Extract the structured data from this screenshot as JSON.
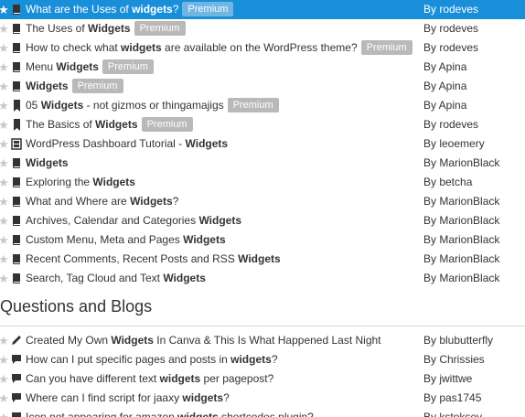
{
  "resources": [
    {
      "title_parts": [
        {
          "t": "What are the Uses of "
        },
        {
          "t": "widgets",
          "b": true
        },
        {
          "t": "?"
        }
      ],
      "premium": "Premium",
      "author": "By rodeves",
      "icon": "book-icon",
      "selected": true
    },
    {
      "title_parts": [
        {
          "t": "The Uses of "
        },
        {
          "t": "Widgets",
          "b": true
        }
      ],
      "premium": "Premium",
      "author": "By rodeves",
      "icon": "book-icon"
    },
    {
      "title_parts": [
        {
          "t": "How to check what "
        },
        {
          "t": "widgets",
          "b": true
        },
        {
          "t": " are available on the WordPress theme?"
        }
      ],
      "premium": "Premium",
      "author": "By rodeves",
      "icon": "book-icon"
    },
    {
      "title_parts": [
        {
          "t": "Menu "
        },
        {
          "t": "Widgets",
          "b": true
        }
      ],
      "premium": "Premium",
      "author": "By Apina",
      "icon": "book-icon"
    },
    {
      "title_parts": [
        {
          "t": "Widgets",
          "b": true
        }
      ],
      "premium": "Premium",
      "author": "By Apina",
      "icon": "book-icon"
    },
    {
      "title_parts": [
        {
          "t": "05 "
        },
        {
          "t": "Widgets",
          "b": true
        },
        {
          "t": " - not gizmos or thingamajigs"
        }
      ],
      "premium": "Premium",
      "author": "By Apina",
      "icon": "bookmark-icon"
    },
    {
      "title_parts": [
        {
          "t": "The Basics of "
        },
        {
          "t": "Widgets",
          "b": true
        }
      ],
      "premium": "Premium",
      "author": "By rodeves",
      "icon": "bookmark-icon"
    },
    {
      "title_parts": [
        {
          "t": "WordPress Dashboard Tutorial - "
        },
        {
          "t": "Widgets",
          "b": true
        }
      ],
      "premium": "",
      "author": "By leoemery",
      "icon": "film-icon"
    },
    {
      "title_parts": [
        {
          "t": "Widgets",
          "b": true
        }
      ],
      "premium": "",
      "author": "By MarionBlack",
      "icon": "book-icon"
    },
    {
      "title_parts": [
        {
          "t": "Exploring the "
        },
        {
          "t": "Widgets",
          "b": true
        }
      ],
      "premium": "",
      "author": "By betcha",
      "icon": "book-icon"
    },
    {
      "title_parts": [
        {
          "t": "What and Where are "
        },
        {
          "t": "Widgets",
          "b": true
        },
        {
          "t": "?"
        }
      ],
      "premium": "",
      "author": "By MarionBlack",
      "icon": "book-icon"
    },
    {
      "title_parts": [
        {
          "t": "Archives, Calendar and Categories "
        },
        {
          "t": "Widgets",
          "b": true
        }
      ],
      "premium": "",
      "author": "By MarionBlack",
      "icon": "book-icon"
    },
    {
      "title_parts": [
        {
          "t": "Custom Menu, Meta and Pages "
        },
        {
          "t": "Widgets",
          "b": true
        }
      ],
      "premium": "",
      "author": "By MarionBlack",
      "icon": "book-icon"
    },
    {
      "title_parts": [
        {
          "t": "Recent Comments, Recent Posts and RSS "
        },
        {
          "t": "Widgets",
          "b": true
        }
      ],
      "premium": "",
      "author": "By MarionBlack",
      "icon": "book-icon"
    },
    {
      "title_parts": [
        {
          "t": "Search, Tag Cloud and Text "
        },
        {
          "t": "Widgets",
          "b": true
        }
      ],
      "premium": "",
      "author": "By MarionBlack",
      "icon": "book-icon"
    }
  ],
  "questions_heading": "Questions and Blogs",
  "questions": [
    {
      "title_parts": [
        {
          "t": "Created My Own "
        },
        {
          "t": "Widgets",
          "b": true
        },
        {
          "t": " In Canva & This Is What Happened Last Night"
        }
      ],
      "premium": "",
      "author": "By blubutterfly",
      "icon": "pencil-icon"
    },
    {
      "title_parts": [
        {
          "t": "How can I put specific pages and posts in "
        },
        {
          "t": "widgets",
          "b": true
        },
        {
          "t": "?"
        }
      ],
      "premium": "",
      "author": "By Chrissies",
      "icon": "speech-bubble-icon"
    },
    {
      "title_parts": [
        {
          "t": "Can you have different text "
        },
        {
          "t": "widgets",
          "b": true
        },
        {
          "t": " per pagepost?"
        }
      ],
      "premium": "",
      "author": "By jwittwe",
      "icon": "speech-bubble-icon"
    },
    {
      "title_parts": [
        {
          "t": "Where can I find script for jaaxy "
        },
        {
          "t": "widgets",
          "b": true
        },
        {
          "t": "?"
        }
      ],
      "premium": "",
      "author": "By pas1745",
      "icon": "speech-bubble-icon"
    },
    {
      "title_parts": [
        {
          "t": "Icon not appearing for amazon "
        },
        {
          "t": "widgets",
          "b": true
        },
        {
          "t": " shortcodes plugin?"
        }
      ],
      "premium": "",
      "author": "By kstoksey",
      "icon": "speech-bubble-icon"
    }
  ],
  "colors": {
    "selected_row": "#1a8fd9",
    "premium_badge": "#b9b9b9",
    "text": "#333333",
    "star_inactive": "#c8c8c8"
  },
  "glyphs": {
    "star": "★"
  }
}
